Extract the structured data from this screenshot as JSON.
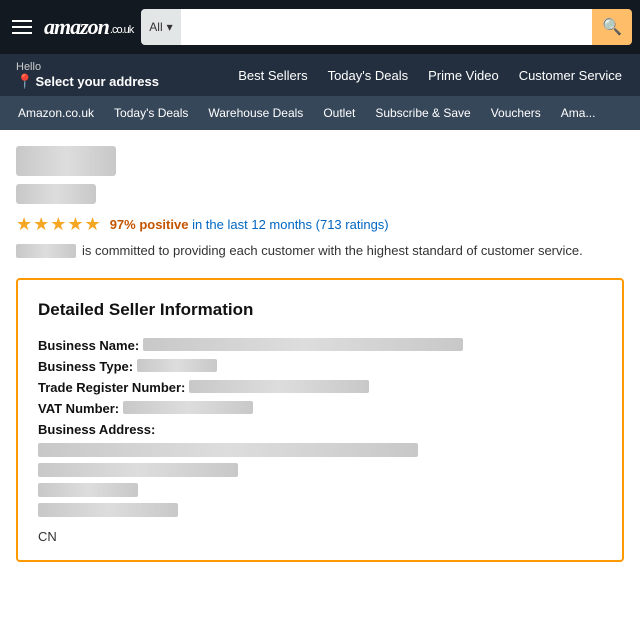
{
  "topNav": {
    "logoText": "amazon",
    "logoDomain": ".co.uk",
    "searchCategory": "All",
    "searchIcon": "🔍"
  },
  "secondNav": {
    "hello": "Hello",
    "selectAddress": "Select your address",
    "links": [
      "Best Sellers",
      "Today's Deals",
      "Prime Video",
      "Customer Service"
    ]
  },
  "catNav": {
    "items": [
      "Amazon.co.uk",
      "Today's Deals",
      "Warehouse Deals",
      "Outlet",
      "Subscribe & Save",
      "Vouchers",
      "Ama..."
    ]
  },
  "sellerPage": {
    "ratingPercent": "97% positive",
    "ratingPeriod": "in the last 12 months (713 ratings)",
    "commitmentText": "is committed to providing each customer with the highest standard of customer service.",
    "sellerInfoTitle": "Detailed Seller Information",
    "fields": {
      "businessNameLabel": "Business Name:",
      "businessTypeLabel": "Business Type:",
      "tradeRegisterLabel": "Trade Register Number:",
      "vatLabel": "VAT Number:",
      "businessAddressLabel": "Business Address:"
    },
    "country": "CN"
  }
}
